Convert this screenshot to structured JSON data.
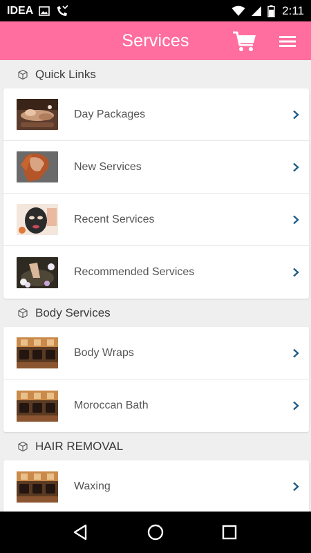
{
  "status_bar": {
    "carrier": "IDEA",
    "time": "2:11",
    "icons": [
      "image-icon",
      "missed-call-icon",
      "wifi-icon",
      "signal-icon",
      "battery-icon"
    ]
  },
  "app_bar": {
    "title": "Services",
    "color": "#ff6e9e",
    "actions": [
      "cart-icon",
      "hamburger-menu-icon"
    ]
  },
  "sections": [
    {
      "title": "Quick Links",
      "items": [
        {
          "label": "Day Packages",
          "thumb": "massage"
        },
        {
          "label": "New Services",
          "thumb": "hair"
        },
        {
          "label": "Recent Services",
          "thumb": "mask"
        },
        {
          "label": "Recommended Services",
          "thumb": "pedicure"
        }
      ]
    },
    {
      "title": "Body Services",
      "items": [
        {
          "label": "Body Wraps",
          "thumb": "salon"
        },
        {
          "label": "Moroccan Bath",
          "thumb": "salon"
        }
      ]
    },
    {
      "title": "HAIR REMOVAL",
      "items": [
        {
          "label": "Waxing",
          "thumb": "salon"
        }
      ]
    }
  ],
  "nav_bar": {
    "buttons": [
      "back-icon",
      "home-icon",
      "recents-icon"
    ]
  }
}
